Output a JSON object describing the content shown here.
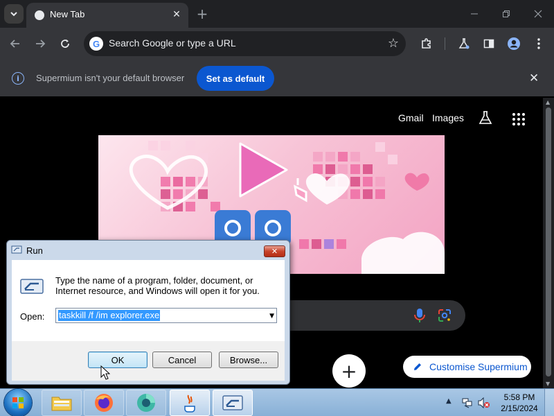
{
  "browser": {
    "tab": {
      "title": "New Tab"
    },
    "omnibox": {
      "placeholder": "Search Google or type a URL"
    },
    "infobar": {
      "message": "Supermium isn't your default browser",
      "action_label": "Set as default"
    }
  },
  "page": {
    "links": {
      "gmail": "Gmail",
      "images": "Images"
    },
    "customise_label": "Customise Supermium"
  },
  "run_dialog": {
    "title": "Run",
    "description": "Type the name of a program, folder, document, or Internet resource, and Windows will open it for you.",
    "open_label": "Open:",
    "command": "taskkill /f /im explorer.exe",
    "buttons": {
      "ok": "OK",
      "cancel": "Cancel",
      "browse": "Browse..."
    }
  },
  "taskbar": {
    "clock": {
      "time": "5:58 PM",
      "date": "2/15/2024"
    },
    "apps": [
      "explorer-icon",
      "firefox-icon",
      "supermium-icon",
      "java-icon",
      "run-icon"
    ]
  },
  "colors": {
    "accent": "#0b57d0",
    "chrome_dark": "#35363a",
    "tab_strip": "#202124",
    "taskbar": "#9fbfdf"
  }
}
